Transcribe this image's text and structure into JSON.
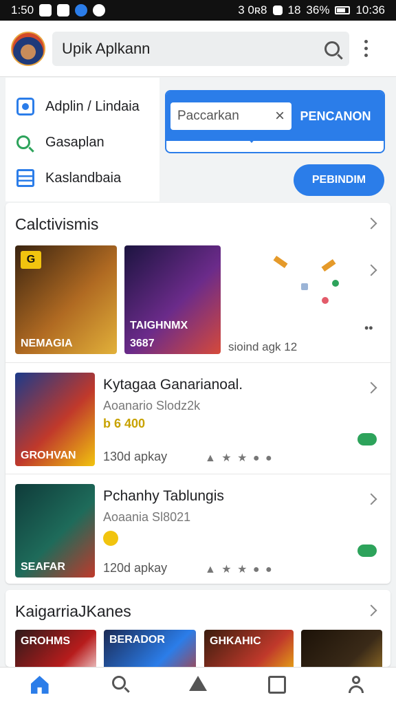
{
  "status_bar": {
    "time": "1:50",
    "right_text": "3 0ʀ8",
    "signal": "18",
    "battery": "36%",
    "clock2": "10:36"
  },
  "header": {
    "search_text": "Upik Aplkann",
    "search_icon": "search-icon",
    "menu_icon": "more-vert-icon"
  },
  "quick_links": [
    {
      "label": "Adplin / Lindaia",
      "icon": "doc-icon"
    },
    {
      "label": "Gasaplan",
      "icon": "search-icon"
    },
    {
      "label": "Kaslandbaia",
      "icon": "list-icon"
    }
  ],
  "popup": {
    "input_text": "Paccarkan",
    "action_label": "PENCANON"
  },
  "pill_button": "PEBINDIM",
  "section1": {
    "title": "Calctivismis",
    "featured": [
      {
        "caption": "NEMAGIA",
        "badge": "G",
        "colors": [
          "#3a2410",
          "#b06a22",
          "#e2b13a"
        ]
      },
      {
        "caption": "TAIGHNMX",
        "badge": "",
        "colors": [
          "#1c1440",
          "#6b2b8a",
          "#d64a3a"
        ]
      }
    ],
    "featured_meta": "3687",
    "side_text": "sioind agk 12",
    "apps": [
      {
        "name": "Kytagaa Ganarianoal.",
        "developer": "Aoanario Slodz2k",
        "price": "b 6 400",
        "size": "130d apkay",
        "stars": "▲ ★ ★ ● ●",
        "art": [
          "#1c3a8a",
          "#c0392b",
          "#f1c40f"
        ],
        "art_caption": "GROHVAN"
      },
      {
        "name": "Pchanhy Tablungis",
        "developer": "Aoaania Sl8021",
        "price": "",
        "size": "120d apkay",
        "stars": "▲ ★ ★ ● ●",
        "art": [
          "#0f3b3a",
          "#1e6b5a",
          "#c0392b"
        ],
        "art_caption": "SEAFAR"
      }
    ]
  },
  "section2": {
    "title": "KaigarriaJKanes",
    "tiles": [
      {
        "caption": "GROHMS",
        "colors": [
          "#2d1a1a",
          "#b71c1c",
          "#ffffff"
        ]
      },
      {
        "caption": "BERADOR",
        "colors": [
          "#1b2a55",
          "#2b7de9",
          "#c0392b"
        ]
      },
      {
        "caption": "GHKAHIC",
        "colors": [
          "#3a1d0e",
          "#c0392b",
          "#f1c40f"
        ]
      },
      {
        "caption": "",
        "colors": [
          "#1c1208",
          "#3a2a18",
          "#a67c2a"
        ]
      }
    ]
  },
  "bottom_nav": [
    {
      "icon": "home-icon"
    },
    {
      "icon": "search-icon"
    },
    {
      "icon": "triangle-icon"
    },
    {
      "icon": "box-icon"
    },
    {
      "icon": "user-icon"
    }
  ],
  "accent_color": "#2b7de9"
}
